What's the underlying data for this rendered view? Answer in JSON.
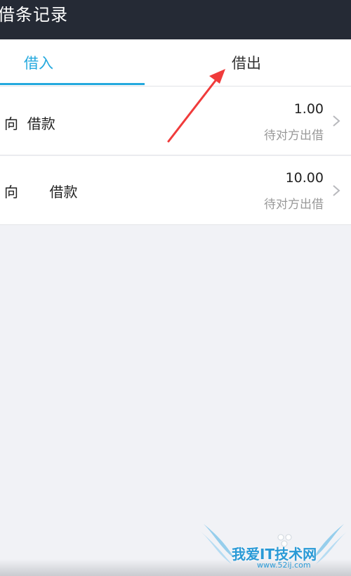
{
  "header": {
    "title": "借条记录"
  },
  "tabs": [
    {
      "label": "借入",
      "active": true
    },
    {
      "label": "借出",
      "active": false
    }
  ],
  "records": [
    {
      "name": "向  借款",
      "amount": "1.00",
      "status": "待对方出借"
    },
    {
      "name": "向       借款",
      "amount": "10.00",
      "status": "待对方出借"
    }
  ],
  "colors": {
    "accent": "#25a9de",
    "header_bg": "#252a35",
    "annotation_arrow": "#f03b3b"
  },
  "watermark": {
    "text": "我爱IT技术网",
    "url": "www.52ij.com"
  }
}
